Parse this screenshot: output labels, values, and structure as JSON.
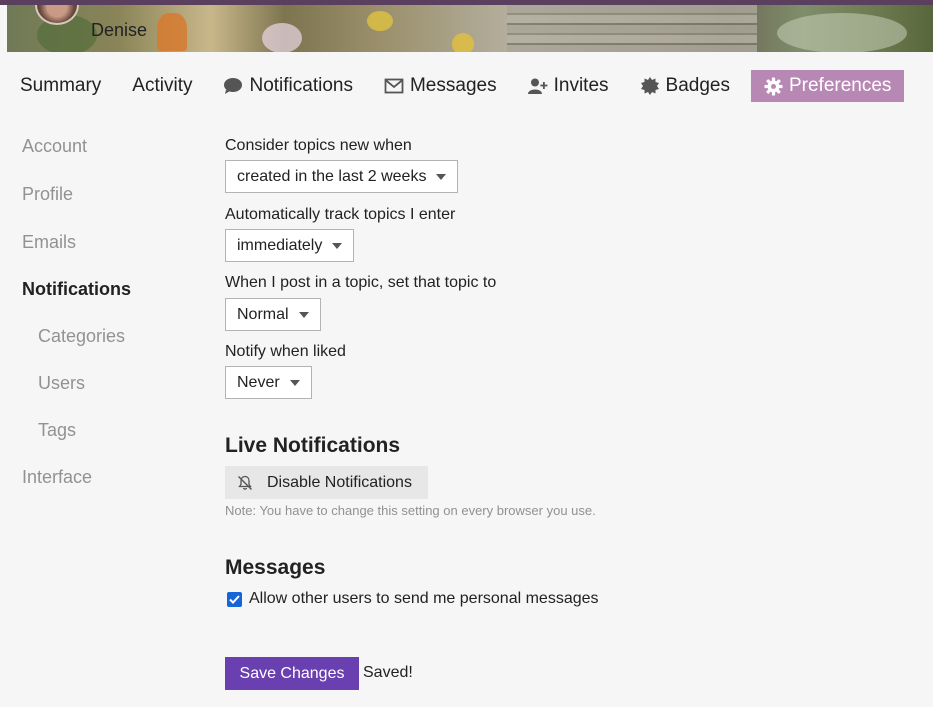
{
  "user": {
    "name": "Denise"
  },
  "nav": {
    "tabs": [
      {
        "label": "Summary",
        "icon": ""
      },
      {
        "label": "Activity",
        "icon": ""
      },
      {
        "label": "Notifications",
        "icon": "comment-icon"
      },
      {
        "label": "Messages",
        "icon": "envelope-icon"
      },
      {
        "label": "Invites",
        "icon": "user-plus-icon"
      },
      {
        "label": "Badges",
        "icon": "certificate-icon"
      },
      {
        "label": "Preferences",
        "icon": "gear-icon",
        "active": true
      }
    ],
    "active_color": "#b888b5"
  },
  "sidebar": {
    "items": [
      {
        "label": "Account"
      },
      {
        "label": "Profile"
      },
      {
        "label": "Emails"
      },
      {
        "label": "Notifications",
        "active": true
      },
      {
        "label": "Categories",
        "sub": true
      },
      {
        "label": "Users",
        "sub": true
      },
      {
        "label": "Tags",
        "sub": true
      },
      {
        "label": "Interface"
      }
    ]
  },
  "settings": {
    "new_topics": {
      "label": "Consider topics new when",
      "value": "created in the last 2 weeks"
    },
    "auto_track": {
      "label": "Automatically track topics I enter",
      "value": "immediately"
    },
    "post_level": {
      "label": "When I post in a topic, set that topic to",
      "value": "Normal"
    },
    "notify_liked": {
      "label": "Notify when liked",
      "value": "Never"
    }
  },
  "live_notifications": {
    "heading": "Live Notifications",
    "button_label": "Disable Notifications",
    "button_icon": "bell-slash-icon",
    "note": "Note: You have to change this setting on every browser you use."
  },
  "messages": {
    "heading": "Messages",
    "allow_pm_label": "Allow other users to send me personal messages",
    "allow_pm_checked": true
  },
  "footer": {
    "save_label": "Save Changes",
    "saved_text": "Saved!",
    "save_color": "#6a3fb0"
  }
}
